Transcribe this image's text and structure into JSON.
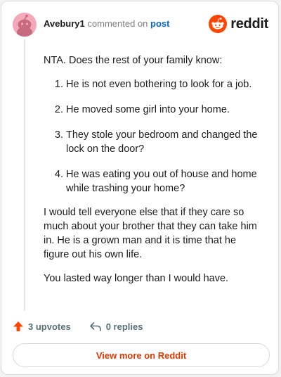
{
  "header": {
    "username": "Avebury1",
    "commented_on": "commented on",
    "post_link": "post"
  },
  "brand": {
    "icon": "reddit-logo-icon",
    "wordmark": "reddit",
    "color": "#ff4500"
  },
  "comment": {
    "intro": "NTA. Does the rest of your family know:",
    "list_items": [
      "He is not even bothering to look for a job.",
      "He moved some girl into your home.",
      "They stole your bedroom and changed the lock on the door?",
      "He was eating you out of house and home while trashing your home?"
    ],
    "paragraphs": [
      "I would tell everyone else that if they care so much about your brother that they can take him in. He is a grown man and it is time that he figure out his own life.",
      "You lasted way longer than I would have."
    ]
  },
  "actions": {
    "upvotes_label": "3 upvotes",
    "upvote_icon": "upvote-arrow-icon",
    "upvote_color": "#ff4500",
    "replies_label": "0 replies",
    "reply_icon": "reply-arrow-icon"
  },
  "view_more": {
    "label": "View more on Reddit",
    "color": "#d93a00"
  }
}
